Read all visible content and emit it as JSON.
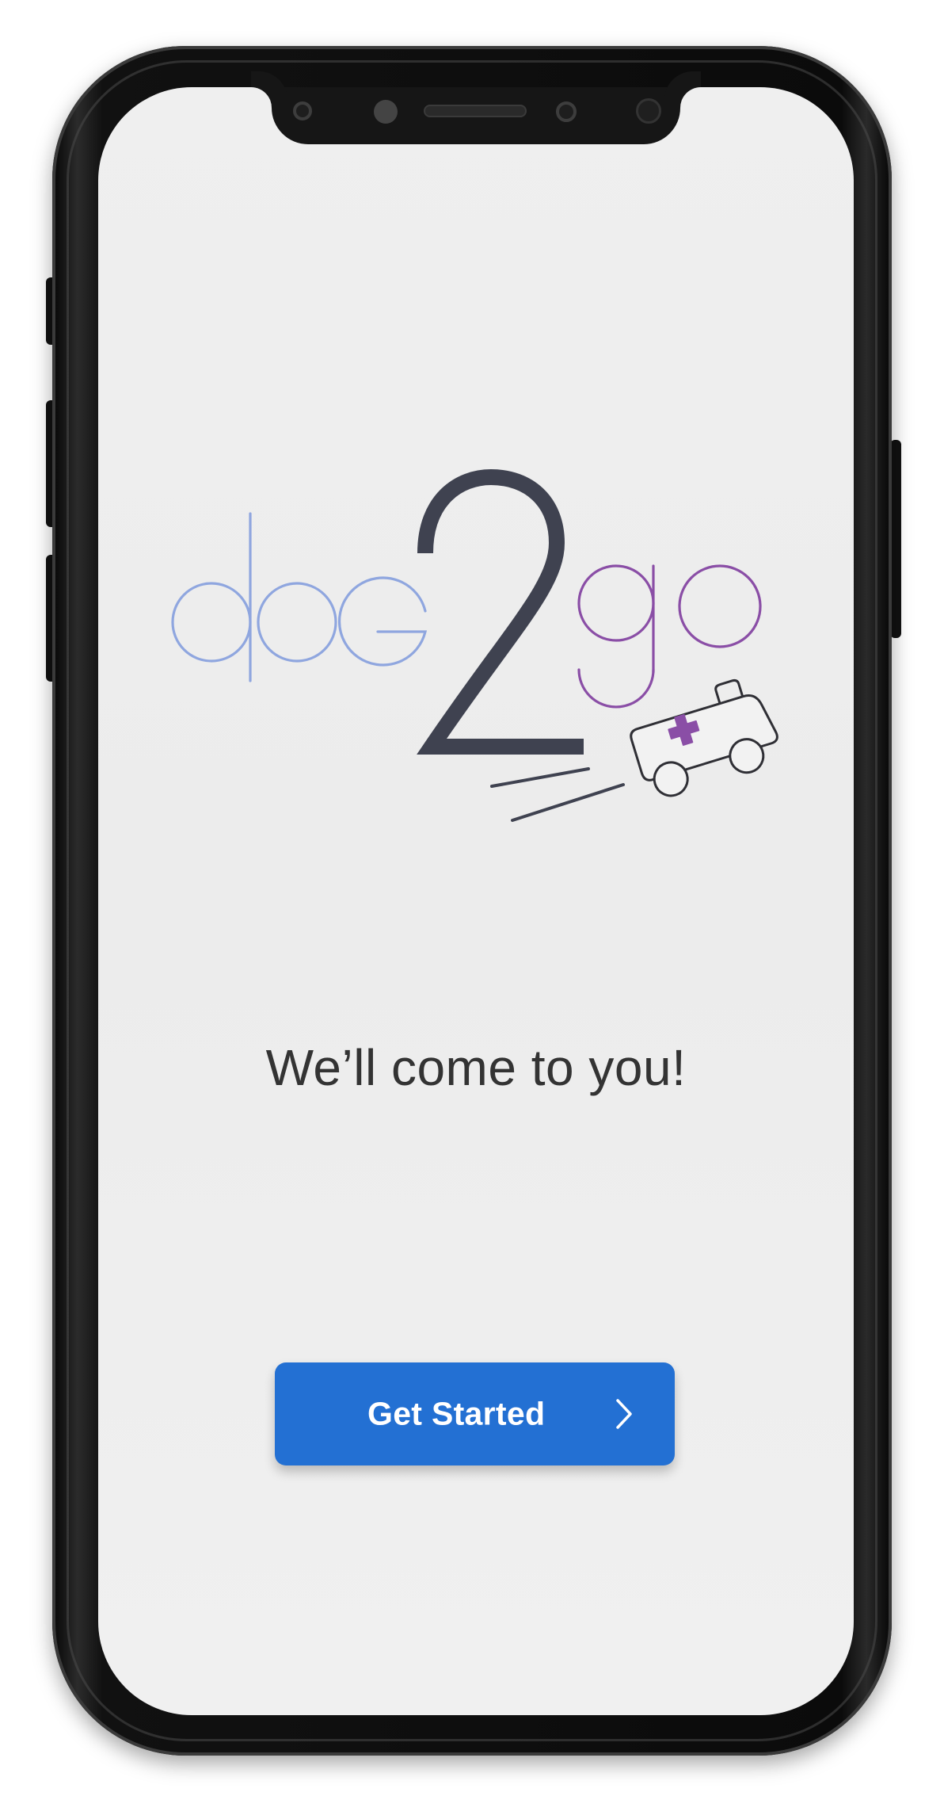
{
  "app": {
    "name": "doc2go",
    "logo_text": {
      "part1": "doc",
      "part2": "2",
      "part3": "go"
    }
  },
  "welcome": {
    "tagline": "We’ll come to you!",
    "cta_label": "Get Started",
    "cta_icon": "chevron-right-icon"
  },
  "colors": {
    "logo_doc": "#8fa6df",
    "logo_two": "#3f4250",
    "logo_go": "#8a4ea6",
    "cta_background": "#2370d3",
    "cta_text": "#ffffff",
    "tagline_text": "#333333",
    "screen_background": "#efefef",
    "frame": "#111111"
  },
  "icons": {
    "ambulance": "ambulance-icon",
    "cross": "medical-cross-icon"
  }
}
